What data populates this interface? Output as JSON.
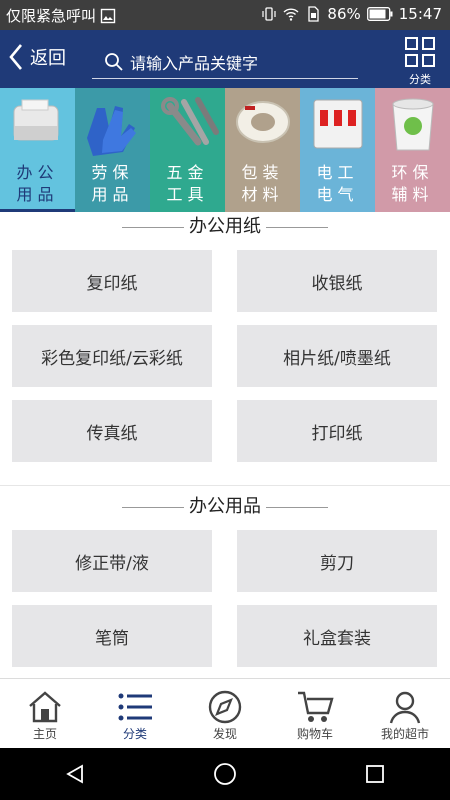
{
  "status_bar": {
    "carrier": "仅限紧急呼叫",
    "battery": "86%",
    "time": "15:47"
  },
  "header": {
    "back_label": "返回",
    "search_placeholder": "请输入产品关键字",
    "category_label": "分类"
  },
  "categories": [
    {
      "label": "办公\n用品",
      "l1": "办公",
      "l2": "用品",
      "color": "#63c3df",
      "icon": "label-printer-icon",
      "active": true
    },
    {
      "label": "劳保用品",
      "l1": "劳保",
      "l2": "用品",
      "color": "#3c9aa8",
      "icon": "gloves-icon",
      "active": false
    },
    {
      "label": "五金工具",
      "l1": "五金",
      "l2": "工具",
      "color": "#2fa98f",
      "icon": "wrench-icon",
      "active": false
    },
    {
      "label": "包装材料",
      "l1": "包装",
      "l2": "材料",
      "color": "#b0a18c",
      "icon": "tape-icon",
      "active": false
    },
    {
      "label": "电工电气",
      "l1": "电工",
      "l2": "电气",
      "color": "#6bb4d8",
      "icon": "breaker-icon",
      "active": false
    },
    {
      "label": "环保辅料",
      "l1": "环保",
      "l2": "辅料",
      "color": "#d19aa8",
      "icon": "paint-bucket-icon",
      "active": false
    }
  ],
  "sections": [
    {
      "title": "办公用纸",
      "items": [
        "复印纸",
        "收银纸",
        "彩色复印纸/云彩纸",
        "相片纸/喷墨纸",
        "传真纸",
        "打印纸"
      ]
    },
    {
      "title": "办公用品",
      "items": [
        "修正带/液",
        "剪刀",
        "笔筒",
        "礼盒套装",
        "",
        ""
      ]
    }
  ],
  "tabbar": [
    {
      "label": "主页",
      "icon": "home-icon",
      "active": false
    },
    {
      "label": "分类",
      "icon": "list-icon",
      "active": true
    },
    {
      "label": "发现",
      "icon": "compass-icon",
      "active": false
    },
    {
      "label": "购物车",
      "icon": "cart-icon",
      "active": false
    },
    {
      "label": "我的超市",
      "icon": "user-icon",
      "active": false
    }
  ],
  "colors": {
    "header_bg": "#1f3a78",
    "accent": "#1f3a78",
    "tile_bg": "#e6e6e8"
  }
}
